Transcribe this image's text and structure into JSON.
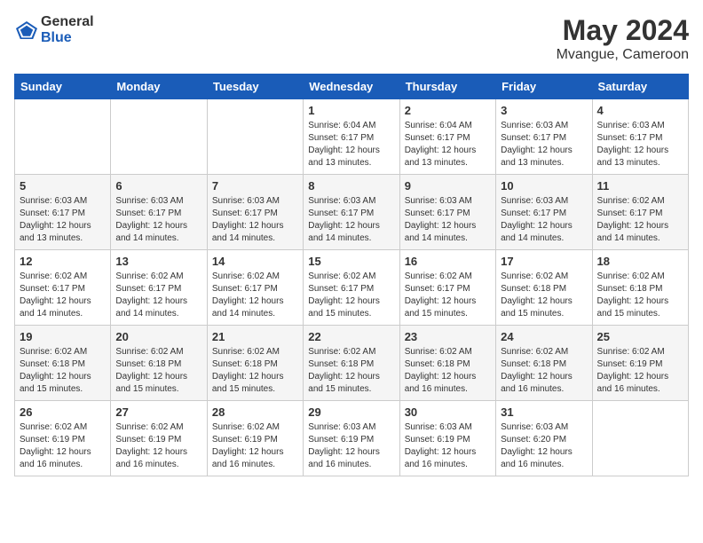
{
  "logo": {
    "text_general": "General",
    "text_blue": "Blue"
  },
  "title": "May 2024",
  "subtitle": "Mvangue, Cameroon",
  "days_of_week": [
    "Sunday",
    "Monday",
    "Tuesday",
    "Wednesday",
    "Thursday",
    "Friday",
    "Saturday"
  ],
  "weeks": [
    [
      {
        "day": "",
        "info": ""
      },
      {
        "day": "",
        "info": ""
      },
      {
        "day": "",
        "info": ""
      },
      {
        "day": "1",
        "info": "Sunrise: 6:04 AM\nSunset: 6:17 PM\nDaylight: 12 hours\nand 13 minutes."
      },
      {
        "day": "2",
        "info": "Sunrise: 6:04 AM\nSunset: 6:17 PM\nDaylight: 12 hours\nand 13 minutes."
      },
      {
        "day": "3",
        "info": "Sunrise: 6:03 AM\nSunset: 6:17 PM\nDaylight: 12 hours\nand 13 minutes."
      },
      {
        "day": "4",
        "info": "Sunrise: 6:03 AM\nSunset: 6:17 PM\nDaylight: 12 hours\nand 13 minutes."
      }
    ],
    [
      {
        "day": "5",
        "info": "Sunrise: 6:03 AM\nSunset: 6:17 PM\nDaylight: 12 hours\nand 13 minutes."
      },
      {
        "day": "6",
        "info": "Sunrise: 6:03 AM\nSunset: 6:17 PM\nDaylight: 12 hours\nand 14 minutes."
      },
      {
        "day": "7",
        "info": "Sunrise: 6:03 AM\nSunset: 6:17 PM\nDaylight: 12 hours\nand 14 minutes."
      },
      {
        "day": "8",
        "info": "Sunrise: 6:03 AM\nSunset: 6:17 PM\nDaylight: 12 hours\nand 14 minutes."
      },
      {
        "day": "9",
        "info": "Sunrise: 6:03 AM\nSunset: 6:17 PM\nDaylight: 12 hours\nand 14 minutes."
      },
      {
        "day": "10",
        "info": "Sunrise: 6:03 AM\nSunset: 6:17 PM\nDaylight: 12 hours\nand 14 minutes."
      },
      {
        "day": "11",
        "info": "Sunrise: 6:02 AM\nSunset: 6:17 PM\nDaylight: 12 hours\nand 14 minutes."
      }
    ],
    [
      {
        "day": "12",
        "info": "Sunrise: 6:02 AM\nSunset: 6:17 PM\nDaylight: 12 hours\nand 14 minutes."
      },
      {
        "day": "13",
        "info": "Sunrise: 6:02 AM\nSunset: 6:17 PM\nDaylight: 12 hours\nand 14 minutes."
      },
      {
        "day": "14",
        "info": "Sunrise: 6:02 AM\nSunset: 6:17 PM\nDaylight: 12 hours\nand 14 minutes."
      },
      {
        "day": "15",
        "info": "Sunrise: 6:02 AM\nSunset: 6:17 PM\nDaylight: 12 hours\nand 15 minutes."
      },
      {
        "day": "16",
        "info": "Sunrise: 6:02 AM\nSunset: 6:17 PM\nDaylight: 12 hours\nand 15 minutes."
      },
      {
        "day": "17",
        "info": "Sunrise: 6:02 AM\nSunset: 6:18 PM\nDaylight: 12 hours\nand 15 minutes."
      },
      {
        "day": "18",
        "info": "Sunrise: 6:02 AM\nSunset: 6:18 PM\nDaylight: 12 hours\nand 15 minutes."
      }
    ],
    [
      {
        "day": "19",
        "info": "Sunrise: 6:02 AM\nSunset: 6:18 PM\nDaylight: 12 hours\nand 15 minutes."
      },
      {
        "day": "20",
        "info": "Sunrise: 6:02 AM\nSunset: 6:18 PM\nDaylight: 12 hours\nand 15 minutes."
      },
      {
        "day": "21",
        "info": "Sunrise: 6:02 AM\nSunset: 6:18 PM\nDaylight: 12 hours\nand 15 minutes."
      },
      {
        "day": "22",
        "info": "Sunrise: 6:02 AM\nSunset: 6:18 PM\nDaylight: 12 hours\nand 15 minutes."
      },
      {
        "day": "23",
        "info": "Sunrise: 6:02 AM\nSunset: 6:18 PM\nDaylight: 12 hours\nand 16 minutes."
      },
      {
        "day": "24",
        "info": "Sunrise: 6:02 AM\nSunset: 6:18 PM\nDaylight: 12 hours\nand 16 minutes."
      },
      {
        "day": "25",
        "info": "Sunrise: 6:02 AM\nSunset: 6:19 PM\nDaylight: 12 hours\nand 16 minutes."
      }
    ],
    [
      {
        "day": "26",
        "info": "Sunrise: 6:02 AM\nSunset: 6:19 PM\nDaylight: 12 hours\nand 16 minutes."
      },
      {
        "day": "27",
        "info": "Sunrise: 6:02 AM\nSunset: 6:19 PM\nDaylight: 12 hours\nand 16 minutes."
      },
      {
        "day": "28",
        "info": "Sunrise: 6:02 AM\nSunset: 6:19 PM\nDaylight: 12 hours\nand 16 minutes."
      },
      {
        "day": "29",
        "info": "Sunrise: 6:03 AM\nSunset: 6:19 PM\nDaylight: 12 hours\nand 16 minutes."
      },
      {
        "day": "30",
        "info": "Sunrise: 6:03 AM\nSunset: 6:19 PM\nDaylight: 12 hours\nand 16 minutes."
      },
      {
        "day": "31",
        "info": "Sunrise: 6:03 AM\nSunset: 6:20 PM\nDaylight: 12 hours\nand 16 minutes."
      },
      {
        "day": "",
        "info": ""
      }
    ]
  ]
}
